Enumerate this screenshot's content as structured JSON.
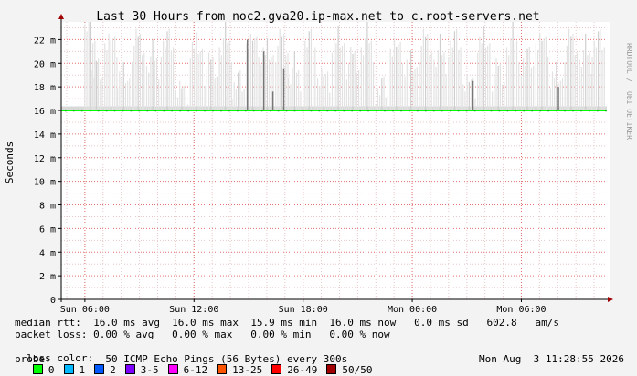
{
  "chart_data": {
    "type": "line",
    "title": "Last 30 Hours from noc2.gva20.ip-max.net to c.root-servers.net",
    "ylabel": "Seconds",
    "y_unit": "ms",
    "ylim": [
      0,
      23.5
    ],
    "y_ticks": [
      {
        "value": 0,
        "label": "0"
      },
      {
        "value": 2,
        "label": "2 m"
      },
      {
        "value": 4,
        "label": "4 m"
      },
      {
        "value": 6,
        "label": "6 m"
      },
      {
        "value": 8,
        "label": "8 m"
      },
      {
        "value": 10,
        "label": "10 m"
      },
      {
        "value": 12,
        "label": "12 m"
      },
      {
        "value": 14,
        "label": "14 m"
      },
      {
        "value": 16,
        "label": "16 m"
      },
      {
        "value": 18,
        "label": "18 m"
      },
      {
        "value": 20,
        "label": "20 m"
      },
      {
        "value": 22,
        "label": "22 m"
      }
    ],
    "x_range_hours": [
      0,
      30
    ],
    "x_ticks": [
      {
        "hour": 1.3,
        "label": "Sun 06:00"
      },
      {
        "hour": 7.3,
        "label": "Sun 12:00"
      },
      {
        "hour": 13.3,
        "label": "Sun 18:00"
      },
      {
        "hour": 19.3,
        "label": "Mon 00:00"
      },
      {
        "hour": 25.3,
        "label": "Mon 06:00"
      }
    ],
    "median_rtt_ms": 16.0,
    "smoke_ceiling_ms": 23.5,
    "smoke_spikes": [
      {
        "hour": 1.6,
        "top": 23.5
      },
      {
        "hour": 1.9,
        "top": 21.0
      },
      {
        "hour": 2.7,
        "top": 23.5
      },
      {
        "hour": 3.4,
        "top": 20.5
      },
      {
        "hour": 4.2,
        "top": 23.5
      },
      {
        "hour": 5.0,
        "top": 22.0
      },
      {
        "hour": 5.8,
        "top": 23.5
      },
      {
        "hour": 6.6,
        "top": 19.5
      },
      {
        "hour": 7.4,
        "top": 23.0
      },
      {
        "hour": 8.2,
        "top": 21.5
      },
      {
        "hour": 9.0,
        "top": 23.5
      },
      {
        "hour": 9.7,
        "top": 20.0
      },
      {
        "hour": 10.5,
        "top": 23.5
      },
      {
        "hour": 11.3,
        "top": 22.5
      },
      {
        "hour": 12.1,
        "top": 23.5
      },
      {
        "hour": 12.8,
        "top": 21.0
      },
      {
        "hour": 13.6,
        "top": 23.5
      },
      {
        "hour": 14.4,
        "top": 20.5
      },
      {
        "hour": 15.2,
        "top": 23.5
      },
      {
        "hour": 16.0,
        "top": 22.0
      },
      {
        "hour": 16.8,
        "top": 23.5
      },
      {
        "hour": 17.6,
        "top": 19.5
      },
      {
        "hour": 18.4,
        "top": 23.0
      },
      {
        "hour": 19.2,
        "top": 21.5
      },
      {
        "hour": 20.0,
        "top": 23.5
      },
      {
        "hour": 20.8,
        "top": 22.5
      },
      {
        "hour": 21.6,
        "top": 23.5
      },
      {
        "hour": 22.4,
        "top": 20.0
      },
      {
        "hour": 23.2,
        "top": 23.5
      },
      {
        "hour": 24.0,
        "top": 21.0
      },
      {
        "hour": 24.8,
        "top": 23.5
      },
      {
        "hour": 25.6,
        "top": 22.0
      },
      {
        "hour": 26.4,
        "top": 23.5
      },
      {
        "hour": 27.2,
        "top": 20.5
      },
      {
        "hour": 28.0,
        "top": 23.5
      },
      {
        "hour": 28.8,
        "top": 22.5
      },
      {
        "hour": 29.5,
        "top": 23.5
      }
    ],
    "dark_spikes": [
      {
        "hour": 10.2,
        "top": 22.0
      },
      {
        "hour": 11.1,
        "top": 21.0
      },
      {
        "hour": 11.6,
        "top": 17.6
      },
      {
        "hour": 12.2,
        "top": 19.5
      },
      {
        "hour": 22.6,
        "top": 18.5
      },
      {
        "hour": 27.3,
        "top": 18.0
      }
    ]
  },
  "side_text": "RRDTOOL / TOBI OETIKER",
  "stats": {
    "median_rtt_line": "median rtt:  16.0 ms avg  16.0 ms max  15.9 ms min  16.0 ms now   0.0 ms sd   602.8   am/s",
    "packet_loss_line": "packet loss: 0.00 % avg   0.00 % max   0.00 % min   0.00 % now",
    "loss_color_label": "loss color:",
    "loss_colors": [
      {
        "label": "0",
        "color": "#00ff00"
      },
      {
        "label": "1",
        "color": "#00b8ff"
      },
      {
        "label": "2",
        "color": "#0059ff"
      },
      {
        "label": "3-5",
        "color": "#7e00ff"
      },
      {
        "label": "6-12",
        "color": "#ff00ff"
      },
      {
        "label": "13-25",
        "color": "#ff5500"
      },
      {
        "label": "26-49",
        "color": "#ff0000"
      },
      {
        "label": "50/50",
        "color": "#a10000"
      }
    ],
    "probe_line": "probe:         50 ICMP Echo Pings (56 Bytes) every 300s",
    "timestamp": "Mon Aug  3 11:28:55 2026"
  },
  "colors": {
    "background": "#f3f3f3",
    "plot_bg": "#ffffff",
    "grid_minor": "#e8c8c8",
    "grid_major": "#e87070",
    "axis": "#000000",
    "arrow": "#a00000",
    "median": "#00ff00"
  }
}
